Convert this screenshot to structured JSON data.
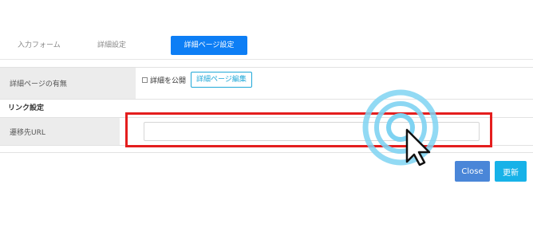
{
  "tabs": [
    {
      "label": "入力フォーム"
    },
    {
      "label": "詳細設定"
    },
    {
      "label": "詳細ページ設定"
    }
  ],
  "detail_page_row": {
    "label": "詳細ページの有無",
    "checkbox_label": "詳細を公開",
    "edit_button": "詳細ページ編集"
  },
  "link_section": {
    "title": "リンク設定",
    "url_label": "遷移先URL",
    "url_value": ""
  },
  "buttons": {
    "close": "Close",
    "update": "更新"
  },
  "colors": {
    "active_tab": "#0d7ef5",
    "close_button": "#4a86d8",
    "update_button": "#17b2e8",
    "highlight": "#e41e1e",
    "click_ring": "#7fd3f2"
  }
}
